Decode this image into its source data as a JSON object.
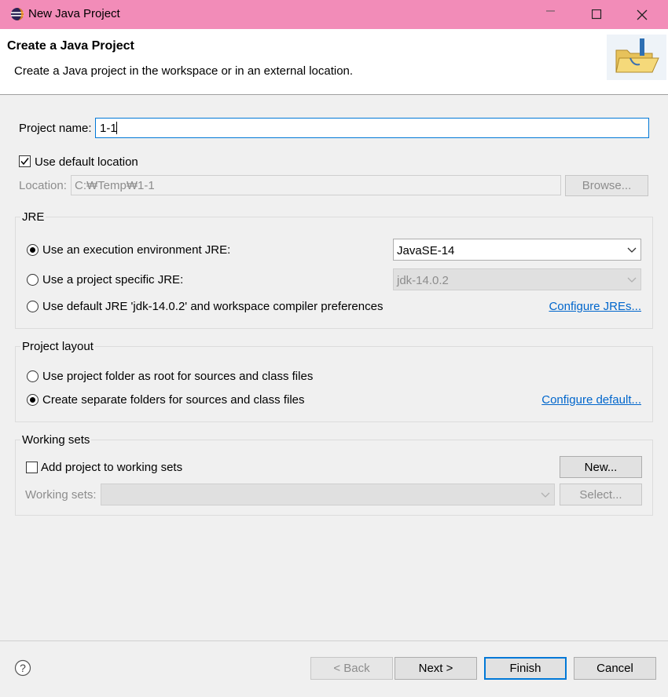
{
  "window": {
    "title": "New Java Project"
  },
  "header": {
    "title": "Create a Java Project",
    "description": "Create a Java project in the workspace or in an external location."
  },
  "project": {
    "name_label": "Project name:",
    "name_value": "1-1"
  },
  "location": {
    "use_default_label": "Use default location",
    "use_default_checked": true,
    "label": "Location:",
    "value": "C:\\Temp\\1-1",
    "display_value": "C:₩Temp₩1-1",
    "browse_label": "Browse..."
  },
  "jre": {
    "group_title": "JRE",
    "option_exec_env": "Use an execution environment JRE:",
    "exec_env_value": "JavaSE-14",
    "option_project_specific": "Use a project specific JRE:",
    "project_specific_value": "jdk-14.0.2",
    "option_default": "Use default JRE 'jdk-14.0.2' and workspace compiler preferences",
    "configure_link": "Configure JREs...",
    "selected": "exec_env"
  },
  "layout": {
    "group_title": "Project layout",
    "option_root": "Use project folder as root for sources and class files",
    "option_separate": "Create separate folders for sources and class files",
    "configure_link": "Configure default...",
    "selected": "separate"
  },
  "working_sets": {
    "group_title": "Working sets",
    "add_label": "Add project to working sets",
    "add_checked": false,
    "new_button": "New...",
    "sets_label": "Working sets:",
    "select_button": "Select..."
  },
  "footer": {
    "back": "< Back",
    "next": "Next >",
    "finish": "Finish",
    "cancel": "Cancel",
    "help_glyph": "?"
  },
  "colors": {
    "titlebar": "#f28cb8",
    "link": "#0066cc",
    "focus_border": "#0078d7"
  },
  "icons": [
    "eclipse-icon",
    "minimize-icon",
    "maximize-icon",
    "close-icon",
    "folder-icon",
    "chevron-down-icon",
    "help-icon"
  ]
}
